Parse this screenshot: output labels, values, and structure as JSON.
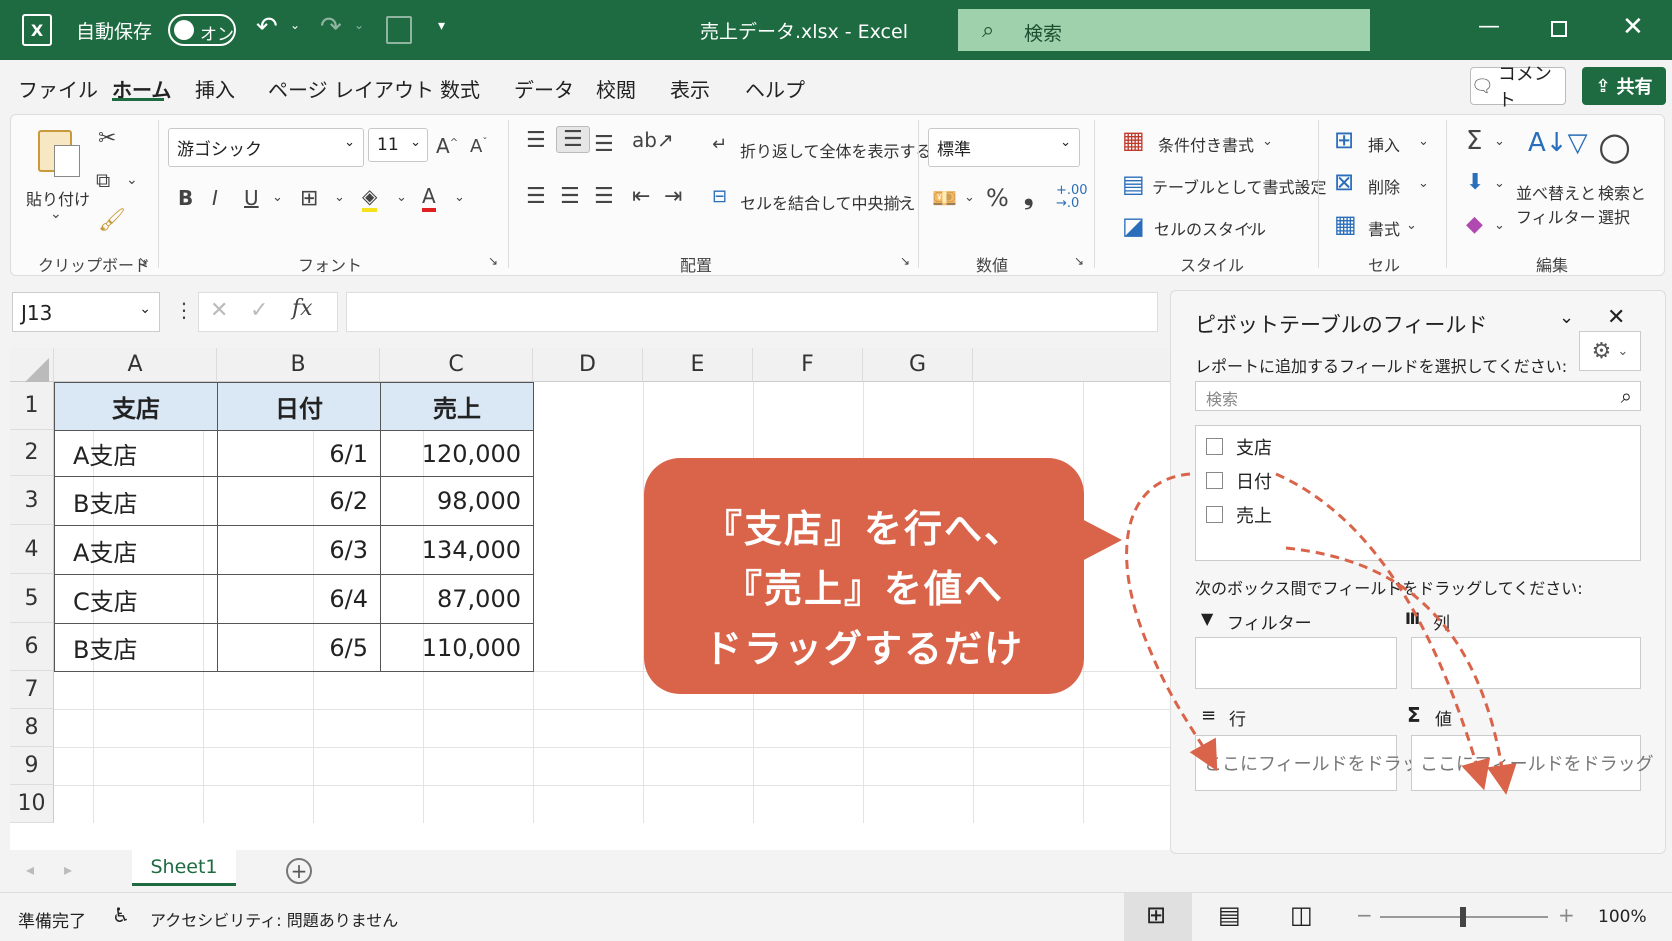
{
  "titlebar": {
    "autosave_label": "自動保存",
    "toggle_state": "オン",
    "doc_title": "売上データ.xlsx  -  Excel",
    "search_placeholder": "検索"
  },
  "menu": {
    "items": [
      "ファイル",
      "ホーム",
      "挿入",
      "ページ レイアウト",
      "数式",
      "データ",
      "校閲",
      "表示",
      "ヘルプ"
    ],
    "comment": "コメント",
    "share": "共有"
  },
  "ribbon": {
    "clipboard": {
      "paste": "貼り付け",
      "group": "クリップボード"
    },
    "font": {
      "name": "游ゴシック",
      "size": "11",
      "bold": "B",
      "italic": "I",
      "underline": "U",
      "group": "フォント"
    },
    "alignment": {
      "wrap": "折り返して全体を表示する",
      "merge": "セルを結合して中央揃え",
      "group": "配置"
    },
    "number": {
      "format": "標準",
      "percent": "%",
      "comma": "❟",
      "group": "数値"
    },
    "styles": {
      "conditional": "条件付き書式",
      "table": "テーブルとして書式設定",
      "cell": "セルのスタイル",
      "group": "スタイル"
    },
    "cells": {
      "insert": "挿入",
      "delete": "削除",
      "format": "書式",
      "group": "セル"
    },
    "editing": {
      "sort1": "並べ替えと",
      "sort2": "フィルター",
      "find1": "検索と",
      "find2": "選択",
      "group": "編集"
    }
  },
  "formula_bar": {
    "name_box": "J13",
    "fx": "fx",
    "content": ""
  },
  "sheet": {
    "columns": [
      "A",
      "B",
      "C",
      "D",
      "E",
      "F",
      "G"
    ],
    "rows": [
      "1",
      "2",
      "3",
      "4",
      "5",
      "6",
      "7",
      "8",
      "9",
      "10"
    ],
    "table": {
      "headers": [
        "支店",
        "日付",
        "売上"
      ],
      "rows": [
        [
          "A支店",
          "6/1",
          "120,000"
        ],
        [
          "B支店",
          "6/2",
          "98,000"
        ],
        [
          "A支店",
          "6/3",
          "134,000"
        ],
        [
          "C支店",
          "6/4",
          "87,000"
        ],
        [
          "B支店",
          "6/5",
          "110,000"
        ]
      ]
    },
    "tab": "Sheet1"
  },
  "callout": {
    "lines": [
      "『支店』を行へ、",
      "『売上』を値へ",
      "ドラッグするだけ"
    ],
    "color": "#d9644a"
  },
  "pivot_pane": {
    "title": "ピボットテーブルのフィールド",
    "subtitle": "レポートに追加するフィールドを選択してください:",
    "search_placeholder": "検索",
    "fields": [
      "支店",
      "日付",
      "売上"
    ],
    "drag_hint": "次のボックス間でフィールドをドラッグしてください:",
    "areas": {
      "filter": "フィルター",
      "columns": "列",
      "rows": "行",
      "values": "値"
    },
    "drop_placeholder": "ここにフィールドをドラッグ"
  },
  "statusbar": {
    "ready": "準備完了",
    "accessibility": "アクセシビリティ: 問題ありません",
    "zoom": "100%"
  },
  "colors": {
    "excel_green": "#1e6b41",
    "header_fill": "#dae7f4",
    "arrow": "#d9644a"
  }
}
